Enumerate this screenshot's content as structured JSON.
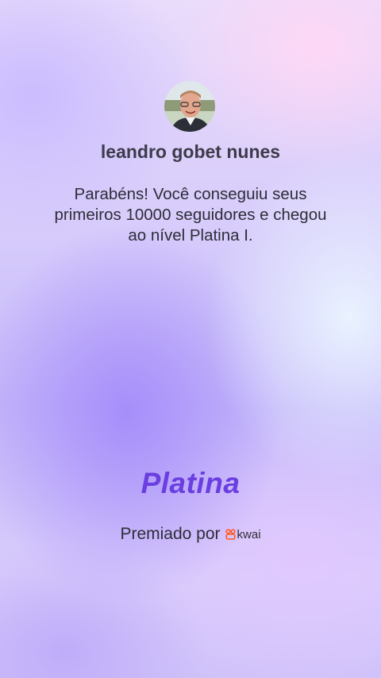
{
  "user": {
    "name": "leandro gobet nunes"
  },
  "achievement": {
    "message": "Parabéns! Você conseguiu seus primeiros 10000 seguidores e chegou ao nível Platina I.",
    "tier_title": "Platina"
  },
  "footer": {
    "awarded_by_label": "Premiado por",
    "brand_icon": "kwai-logo-icon",
    "brand_name": "kwai"
  },
  "colors": {
    "tier_accent": "#6a3ee0",
    "brand_orange": "#ff5a1f"
  }
}
